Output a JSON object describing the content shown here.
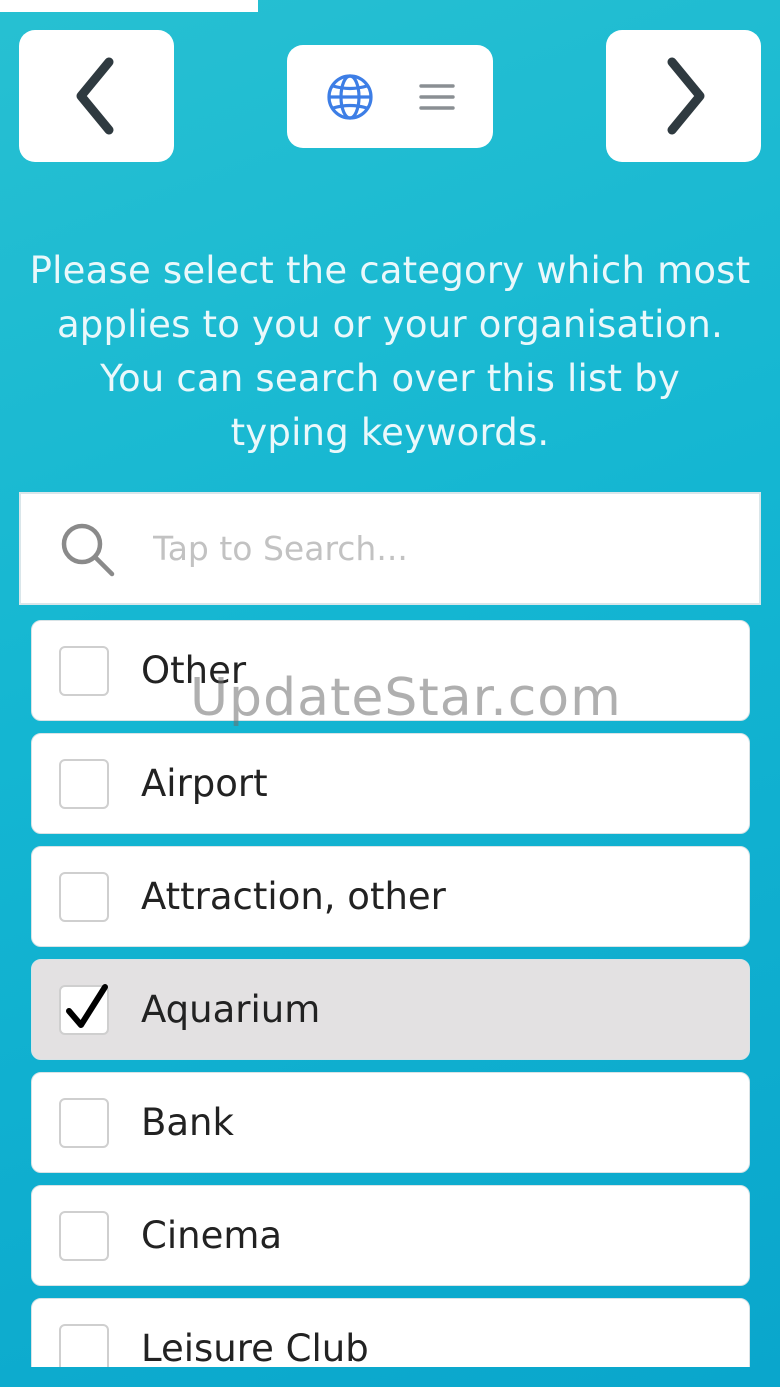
{
  "header": {
    "back_icon": "chevron-left-icon",
    "forward_icon": "chevron-right-icon",
    "language_icon": "globe-icon",
    "menu_icon": "hamburger-menu-icon",
    "accent_color": "#3d7ee6",
    "chevron_color": "#2f3a40"
  },
  "instructions": {
    "line1": "Please select the category which most",
    "line2": "applies to you or your organisation.",
    "line3": "You can search over this list by",
    "line4": "typing keywords."
  },
  "search": {
    "placeholder": "Tap to Search...",
    "value": ""
  },
  "categories": [
    {
      "label": "Other",
      "checked": false
    },
    {
      "label": "Airport",
      "checked": false
    },
    {
      "label": "Attraction, other",
      "checked": false
    },
    {
      "label": "Aquarium",
      "checked": true
    },
    {
      "label": "Bank",
      "checked": false
    },
    {
      "label": "Cinema",
      "checked": false
    },
    {
      "label": "Leisure Club",
      "checked": false
    }
  ],
  "watermark": "UpdateStar.com",
  "colors": {
    "background": "#14b6d2",
    "selected_row": "#e3e1e2"
  }
}
